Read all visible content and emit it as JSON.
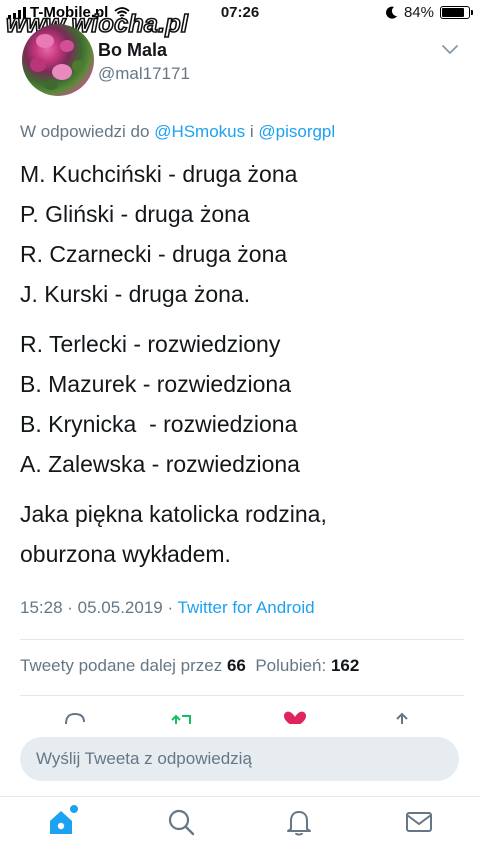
{
  "status_bar": {
    "carrier": "T-Mobile.pl",
    "time": "07:26",
    "battery": "84%",
    "battery_level": 0.84
  },
  "watermark": "www.wiocha.pl",
  "author": {
    "display_name": "Bo Mala",
    "handle": "@mal17171"
  },
  "tweet": {
    "reply_prefix": "W odpowiedzi do ",
    "reply_mention_1": "@HSmokus",
    "reply_join": " i ",
    "reply_mention_2": "@pisorgpl",
    "lines_group_1": [
      "M. Kuchciński - druga żona",
      "P. Gliński - druga żona",
      "R. Czarnecki - druga żona",
      "J. Kurski - druga żona."
    ],
    "lines_group_2": [
      "R. Terlecki - rozwiedziony",
      "B. Mazurek - rozwiedziona",
      "B. Krynicka  - rozwiedziona",
      "A. Zalewska - rozwiedziona"
    ],
    "lines_group_3": [
      "Jaka piękna katolicka rodzina,",
      "oburzona wykładem."
    ],
    "timestamp": "15:28 · 05.05.2019 · ",
    "client": "Twitter for Android"
  },
  "stats": {
    "retweets_label": "Tweety podane dalej przez ",
    "retweets_count": "66",
    "likes_label": "Polubień: ",
    "likes_count": "162"
  },
  "reply_box": {
    "placeholder": "Wyślij Tweeta z odpowiedzią"
  },
  "colors": {
    "accent": "#1da1f2",
    "retweet": "#17bf63",
    "like": "#e0245e",
    "muted": "#657786"
  }
}
